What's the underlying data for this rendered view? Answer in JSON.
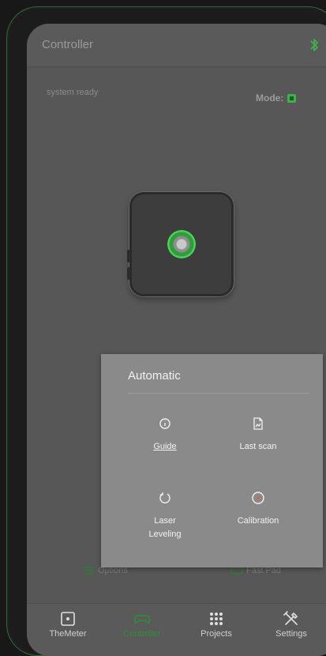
{
  "appbar": {
    "title": "Controller",
    "bluetooth_icon": "bluetooth-icon"
  },
  "status": {
    "text": "system ready",
    "mode_label": "Mode:"
  },
  "device": {
    "icon": "device-icon"
  },
  "sheet": {
    "title": "Automatic",
    "actions": [
      {
        "label": "Guide",
        "icon": "info-icon",
        "underlined": true
      },
      {
        "label": "Last scan",
        "icon": "file-icon"
      },
      {
        "label": "Laser\nLeveling",
        "icon": "refresh-icon"
      },
      {
        "label": "Calibration",
        "icon": "compass-icon"
      }
    ]
  },
  "shortcuts": {
    "options": "Options",
    "fast_pad": "Fast Pad"
  },
  "tabs": [
    {
      "label": "TheMeter",
      "icon": "square-dot-icon"
    },
    {
      "label": "Controller",
      "icon": "gamepad-icon",
      "active": true
    },
    {
      "label": "Projects",
      "icon": "grid-icon"
    },
    {
      "label": "Settings",
      "icon": "tools-icon"
    }
  ],
  "colors": {
    "accent": "#2d8f38",
    "screen": "#575757",
    "sheet": "#8a8a8a"
  }
}
